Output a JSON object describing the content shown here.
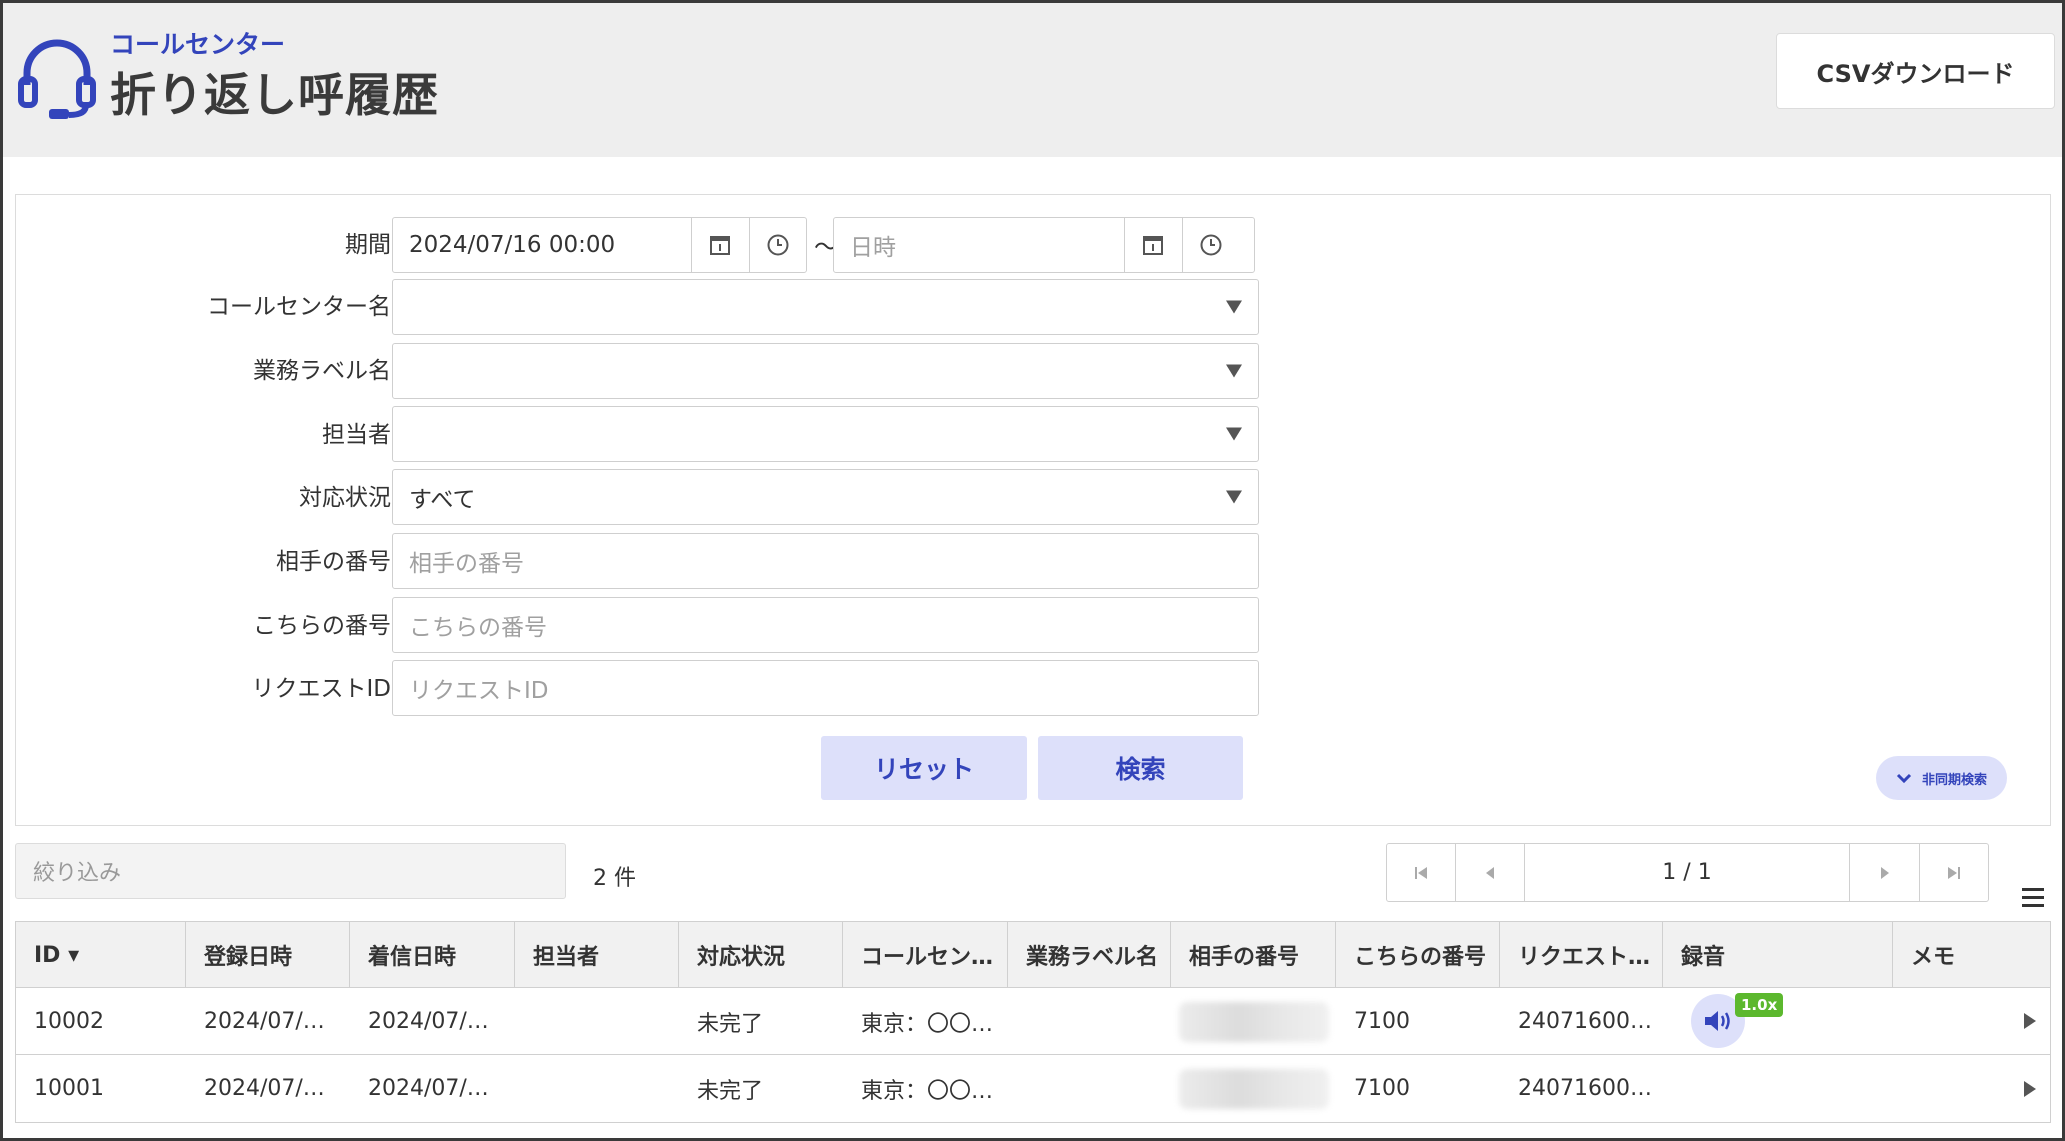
{
  "header": {
    "subtitle": "コールセンター",
    "title": "折り返し呼履歴",
    "csv_button": "CSVダウンロード"
  },
  "search": {
    "period_label": "期間",
    "period_start_value": "2024/07/16 00:00",
    "period_separator": "～",
    "period_end_placeholder": "日時",
    "callcenter_label": "コールセンター名",
    "callcenter_value": "",
    "business_label_label": "業務ラベル名",
    "business_label_value": "",
    "assignee_label": "担当者",
    "assignee_value": "",
    "status_label": "対応状況",
    "status_value": "すべて",
    "their_number_label": "相手の番号",
    "their_number_placeholder": "相手の番号",
    "our_number_label": "こちらの番号",
    "our_number_placeholder": "こちらの番号",
    "request_id_label": "リクエストID",
    "request_id_placeholder": "リクエストID",
    "reset_button": "リセット",
    "search_button": "検索",
    "async_search_button": "非同期検索"
  },
  "list": {
    "filter_placeholder": "絞り込み",
    "count": "2 件",
    "page": "1 / 1"
  },
  "table": {
    "columns": [
      "ID ▾",
      "登録日時",
      "着信日時",
      "担当者",
      "対応状況",
      "コールセン…",
      "業務ラベル名",
      "相手の番号",
      "こちらの番号",
      "リクエスト…",
      "録音",
      "メモ"
    ],
    "rows": [
      {
        "id": "10002",
        "registered": "2024/07/…",
        "received": "2024/07/…",
        "assignee": "",
        "status": "未完了",
        "callcenter": "東京：〇〇…",
        "business_label": "",
        "their_number": "(blurred)",
        "our_number": "7100",
        "request_id": "24071600…",
        "recording_speed": "1.0x",
        "memo": ""
      },
      {
        "id": "10001",
        "registered": "2024/07/…",
        "received": "2024/07/…",
        "assignee": "",
        "status": "未完了",
        "callcenter": "東京：〇〇…",
        "business_label": "",
        "their_number": "(blurred)",
        "our_number": "7100",
        "request_id": "24071600…",
        "recording_speed": "",
        "memo": ""
      }
    ]
  },
  "colors": {
    "accent": "#3344bb",
    "button_bg": "#dde0fa",
    "speed_badge": "#5cb82e",
    "header_bg": "#eeeeee"
  },
  "icons": [
    "headset-icon",
    "calendar-icon",
    "clock-icon",
    "chevron-down-icon",
    "first-page-icon",
    "prev-page-icon",
    "next-page-icon",
    "last-page-icon",
    "menu-icon",
    "speaker-icon",
    "play-icon",
    "dropdown-caret-icon"
  ]
}
